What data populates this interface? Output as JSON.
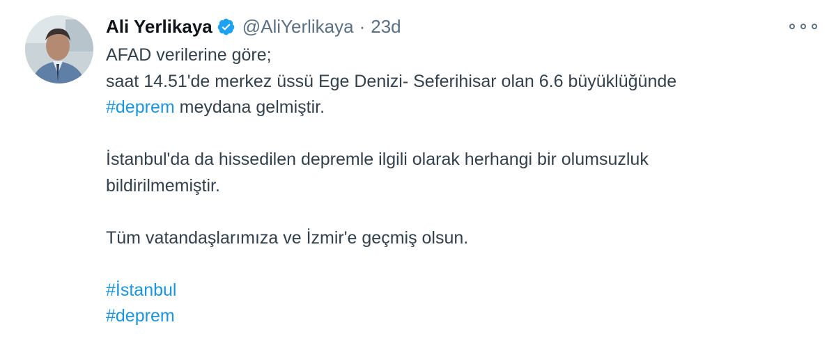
{
  "author": {
    "display_name": "Ali Yerlikaya",
    "handle": "@AliYerlikaya",
    "separator": "·",
    "time": "23d",
    "avatar_icon": "profile-photo",
    "verified_icon": "verified-badge-icon"
  },
  "tweet": {
    "line1": "AFAD verilerine göre;",
    "line2": "saat 14.51'de merkez üssü Ege Denizi- Seferihisar olan 6.6 büyüklüğünde",
    "line3_hashtag": "#deprem",
    "line3_rest": " meydana gelmiştir.",
    "para2_line1": "İstanbul'da da hissedilen depremle ilgili olarak herhangi bir olumsuzluk",
    "para2_line2": "bildirilmemiştir.",
    "para3": "Tüm vatandaşlarımıza ve İzmir'e geçmiş olsun.",
    "hashtags": [
      "#İstanbul",
      "#deprem"
    ]
  },
  "colors": {
    "link": "#1b95e0",
    "secondary_text": "#5b7083",
    "verified": "#1da1f2"
  },
  "more_icon": "more-options-icon"
}
